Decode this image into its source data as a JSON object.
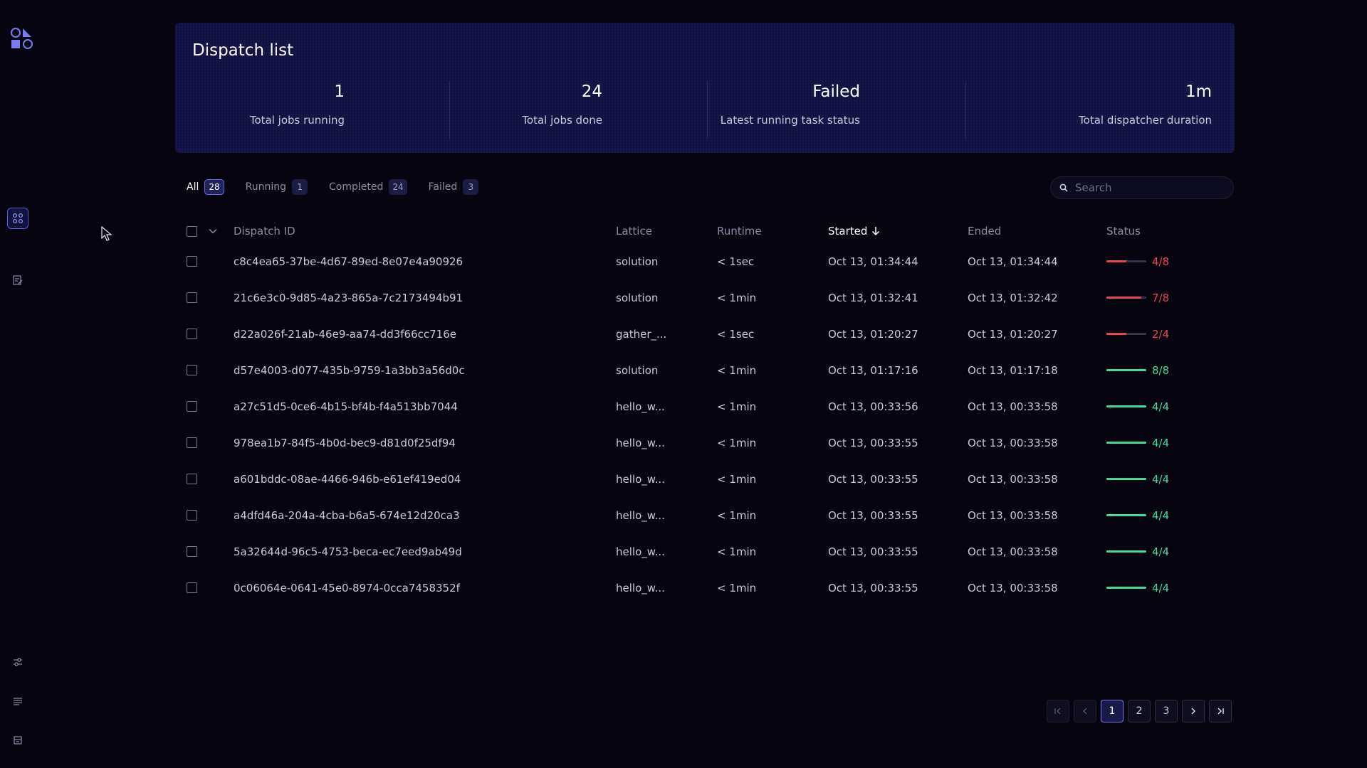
{
  "header": {
    "title": "Dispatch list",
    "stats": [
      {
        "value": "1",
        "label": "Total jobs running"
      },
      {
        "value": "24",
        "label": "Total jobs done"
      },
      {
        "value": "Failed",
        "label": "Latest running task status"
      },
      {
        "value": "1m",
        "label": "Total dispatcher duration"
      }
    ]
  },
  "tabs": [
    {
      "label": "All",
      "count": "28"
    },
    {
      "label": "Running",
      "count": "1"
    },
    {
      "label": "Completed",
      "count": "24"
    },
    {
      "label": "Failed",
      "count": "3"
    }
  ],
  "search": {
    "placeholder": "Search"
  },
  "table": {
    "columns": {
      "id": "Dispatch ID",
      "lattice": "Lattice",
      "runtime": "Runtime",
      "started": "Started",
      "ended": "Ended",
      "status": "Status"
    },
    "rows": [
      {
        "id": "c8c4ea65-37be-4d67-89ed-8e07e4a90926",
        "lattice": "solution",
        "runtime": "< 1sec",
        "started": "Oct 13, 01:34:44",
        "ended": "Oct 13, 01:34:44",
        "status": "4/8",
        "fraction": 0.5,
        "state": "failed"
      },
      {
        "id": "21c6e3c0-9d85-4a23-865a-7c2173494b91",
        "lattice": "solution",
        "runtime": "< 1min",
        "started": "Oct 13, 01:32:41",
        "ended": "Oct 13, 01:32:42",
        "status": "7/8",
        "fraction": 0.875,
        "state": "failed"
      },
      {
        "id": "d22a026f-21ab-46e9-aa74-dd3f66cc716e",
        "lattice": "gather_...",
        "runtime": "< 1sec",
        "started": "Oct 13, 01:20:27",
        "ended": "Oct 13, 01:20:27",
        "status": "2/4",
        "fraction": 0.5,
        "state": "failed"
      },
      {
        "id": "d57e4003-d077-435b-9759-1a3bb3a56d0c",
        "lattice": "solution",
        "runtime": "< 1min",
        "started": "Oct 13, 01:17:16",
        "ended": "Oct 13, 01:17:18",
        "status": "8/8",
        "fraction": 1,
        "state": "completed"
      },
      {
        "id": "a27c51d5-0ce6-4b15-bf4b-f4a513bb7044",
        "lattice": "hello_w...",
        "runtime": "< 1min",
        "started": "Oct 13, 00:33:56",
        "ended": "Oct 13, 00:33:58",
        "status": "4/4",
        "fraction": 1,
        "state": "completed"
      },
      {
        "id": "978ea1b7-84f5-4b0d-bec9-d81d0f25df94",
        "lattice": "hello_w...",
        "runtime": "< 1min",
        "started": "Oct 13, 00:33:55",
        "ended": "Oct 13, 00:33:58",
        "status": "4/4",
        "fraction": 1,
        "state": "completed"
      },
      {
        "id": "a601bddc-08ae-4466-946b-e61ef419ed04",
        "lattice": "hello_w...",
        "runtime": "< 1min",
        "started": "Oct 13, 00:33:55",
        "ended": "Oct 13, 00:33:58",
        "status": "4/4",
        "fraction": 1,
        "state": "completed"
      },
      {
        "id": "a4dfd46a-204a-4cba-b6a5-674e12d20ca3",
        "lattice": "hello_w...",
        "runtime": "< 1min",
        "started": "Oct 13, 00:33:55",
        "ended": "Oct 13, 00:33:58",
        "status": "4/4",
        "fraction": 1,
        "state": "completed"
      },
      {
        "id": "5a32644d-96c5-4753-beca-ec7eed9ab49d",
        "lattice": "hello_w...",
        "runtime": "< 1min",
        "started": "Oct 13, 00:33:55",
        "ended": "Oct 13, 00:33:58",
        "status": "4/4",
        "fraction": 1,
        "state": "completed"
      },
      {
        "id": "0c06064e-0641-45e0-8974-0cca7458352f",
        "lattice": "hello_w...",
        "runtime": "< 1min",
        "started": "Oct 13, 00:33:55",
        "ended": "Oct 13, 00:33:58",
        "status": "4/4",
        "fraction": 1,
        "state": "completed"
      }
    ]
  },
  "pagination": {
    "pages": [
      "1",
      "2",
      "3"
    ],
    "current": "1"
  },
  "colors": {
    "failed": "#e5484d",
    "completed": "#3ddc97",
    "accent": "#5b5bd6"
  },
  "icons": {
    "logo": "covalent-logo-icon",
    "nav": [
      "dispatch-list-icon",
      "lattice-editor-icon",
      "settings-sliders-icon",
      "logs-icon",
      "queue-icon"
    ]
  }
}
